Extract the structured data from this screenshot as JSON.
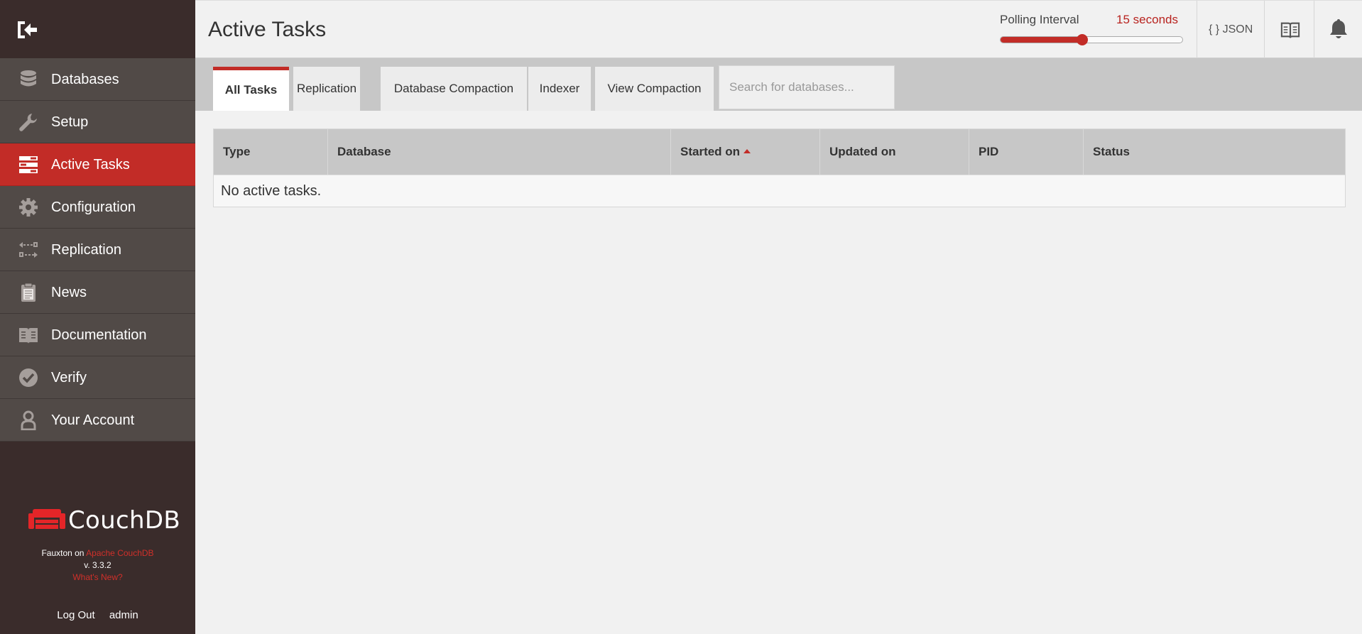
{
  "header": {
    "title": "Active Tasks",
    "polling": {
      "label": "Polling Interval",
      "value": "15 seconds",
      "level": 0.45
    },
    "json_label": "{ } JSON"
  },
  "sidebar": {
    "items": [
      {
        "label": "Databases",
        "icon": "database-icon",
        "active": false
      },
      {
        "label": "Setup",
        "icon": "wrench-icon",
        "active": false
      },
      {
        "label": "Active Tasks",
        "icon": "tasks-icon",
        "active": true
      },
      {
        "label": "Configuration",
        "icon": "gear-icon",
        "active": false
      },
      {
        "label": "Replication",
        "icon": "replication-icon",
        "active": false
      },
      {
        "label": "News",
        "icon": "clipboard-icon",
        "active": false
      },
      {
        "label": "Documentation",
        "icon": "book-icon",
        "active": false
      },
      {
        "label": "Verify",
        "icon": "check-circle-icon",
        "active": false
      },
      {
        "label": "Your Account",
        "icon": "user-icon",
        "active": false
      }
    ],
    "brand": {
      "name": "CouchDB",
      "fauxton_on": "Fauxton on",
      "apache_link": "Apache CouchDB",
      "version": "v. 3.3.2",
      "whats_new": "What's New?"
    },
    "footer": {
      "logout": "Log Out",
      "user": "admin"
    }
  },
  "tabs": {
    "items": [
      "All Tasks",
      "Replication",
      "Database Compaction",
      "Indexer",
      "View Compaction"
    ],
    "active": "All Tasks",
    "search_placeholder": "Search for databases..."
  },
  "table": {
    "columns": [
      "Type",
      "Database",
      "Started on",
      "Updated on",
      "PID",
      "Status"
    ],
    "sorted_column": "Started on",
    "sort_direction": "ascending",
    "empty_message": "No active tasks."
  },
  "colors": {
    "accent": "#c22c27",
    "sidebar_bg": "#3a2c2b",
    "nav_item_bg": "#514a47"
  }
}
